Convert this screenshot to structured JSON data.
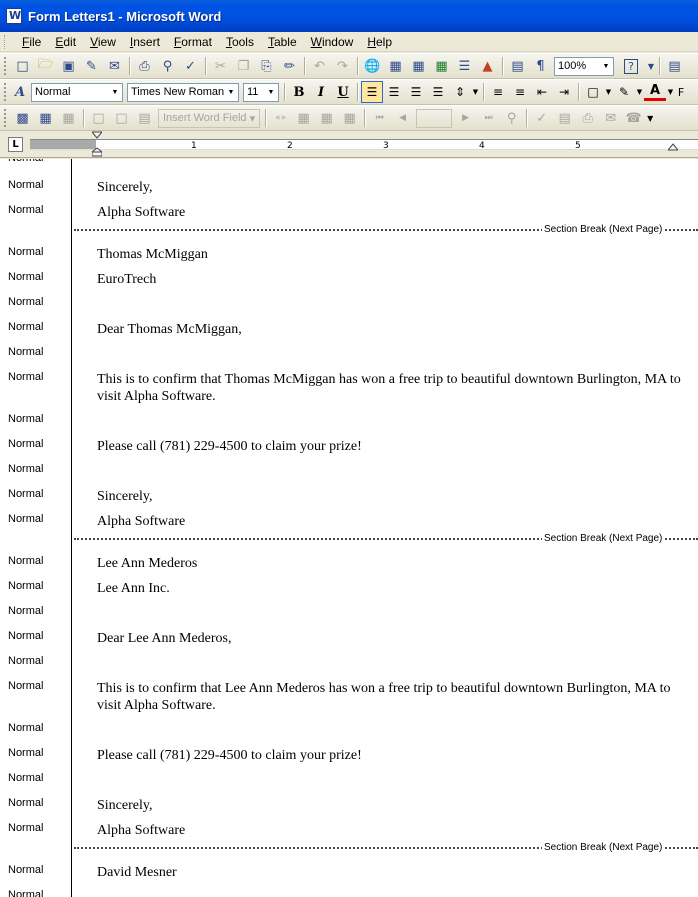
{
  "window": {
    "title": "Form Letters1 - Microsoft Word"
  },
  "menu": [
    "File",
    "Edit",
    "View",
    "Insert",
    "Format",
    "Tools",
    "Table",
    "Window",
    "Help"
  ],
  "formatting": {
    "style": "Normal",
    "font": "Times New Roman",
    "size": "11",
    "bold": "B",
    "italic": "I",
    "underline": "U",
    "font_color_letter": "A",
    "trailing_letter": "F"
  },
  "standard": {
    "zoom": "100%",
    "help_icon": "?",
    "pilcrow": "¶"
  },
  "mail_merge": {
    "insert_word_field": "Insert Word Field"
  },
  "ruler": {
    "tab_selector": "L",
    "numbers": [
      "1",
      "2",
      "3",
      "4",
      "5"
    ]
  },
  "style_area": {
    "label": "Normal"
  },
  "section_break_label": "Section Break (Next Page)",
  "letters": [
    {
      "top_lines": [
        "Sincerely,",
        "Alpha Software"
      ]
    },
    {
      "name": "Thomas McMiggan",
      "company": "EuroTrech",
      "greeting": "Dear Thomas McMiggan,",
      "body": "This is to confirm that Thomas McMiggan has won a free trip to beautiful downtown Burlington, MA to visit Alpha Software.",
      "call": "Please call (781) 229-4500 to claim your prize!",
      "closing": "Sincerely,",
      "signature": "Alpha Software"
    },
    {
      "name": "Lee Ann Mederos",
      "company": "Lee Ann Inc.",
      "greeting": "Dear Lee Ann Mederos,",
      "body": "This is to confirm that Lee Ann Mederos has won a free trip to beautiful downtown Burlington, MA to visit Alpha Software.",
      "call": "Please call (781) 229-4500 to claim your prize!",
      "closing": "Sincerely,",
      "signature": "Alpha Software"
    },
    {
      "name": "David Mesner"
    }
  ]
}
